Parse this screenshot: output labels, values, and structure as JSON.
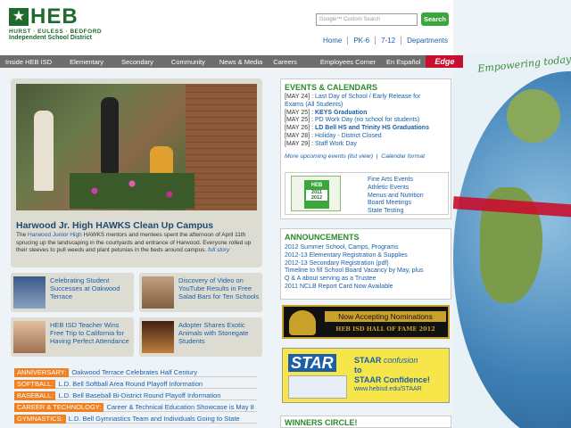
{
  "header": {
    "logo_main": "HEB",
    "logo_sub1": "HURST · EULESS · BEDFORD",
    "logo_sub2": "Independent School District",
    "search_placeholder": "Google™ Custom Search",
    "search_button": "Search",
    "top_links": [
      "Home",
      "PK-6",
      "7-12",
      "Departments"
    ]
  },
  "nav": {
    "items": [
      "Inside HEB ISD",
      "Elementary",
      "Secondary",
      "Community",
      "News & Media",
      "Careers",
      "Employees Corner",
      "En Español"
    ],
    "edge": "Edge"
  },
  "tagline": "Empowering today to...",
  "feature": {
    "title": "Harwood Jr. High HAWKS Clean Up Campus",
    "text_before": "The ",
    "link": "Harwood Junior High",
    "text_after": " HAWKS mentors and mentees spent the afternoon of April 11th sprucing up the landscaping in the courtyards and entrance of Harwood. Everyone rolled up their sleeves to pull weeds and plant petunias in the beds around campus.",
    "full_story": "full story"
  },
  "tiles": [
    {
      "text": "Celebrating Student Successes at Oakwood Terrace"
    },
    {
      "text": "Discovery of Video on YouTube Results in Free Salad Bars for Ten Schools"
    },
    {
      "text": "HEB ISD Teacher Wins Free Trip to California for Having Perfect Attendance"
    },
    {
      "text": "Adopter Shares Exotic Animals with Stonegate Students"
    }
  ],
  "news": [
    {
      "tag": "ANNIVERSARY:",
      "text": "Oakwood Terrace Celebrates Half Century"
    },
    {
      "tag": "SOFTBALL:",
      "text": "L.D. Bell Softball Area Round Playoff Information"
    },
    {
      "tag": "BASEBALL:",
      "text": "L.D. Bell Baseball Bi-District Round Playoff Information"
    },
    {
      "tag": "CAREER & TECHNOLOGY:",
      "text": "Career & Technical Education Showcase is May 8"
    },
    {
      "tag": "GYMNASTICS:",
      "text": "L.D. Bell Gymnastics Team and Individuals Going to State"
    }
  ],
  "events": {
    "title": "EVENTS & CALENDARS",
    "rows": [
      {
        "date": "[MAY 24] :",
        "text": "Last Day of School / Early Release for"
      },
      {
        "date": "",
        "text": "Exams (All Students)"
      },
      {
        "date": "[MAY 25] :",
        "text": "KEYS Graduation",
        "bold": true
      },
      {
        "date": "[MAY 25] :",
        "text": "PD Work Day (no school for students)"
      },
      {
        "date": "[MAY 26] :",
        "text": "LD Bell HS and Trinity HS Graduations",
        "bold": true
      },
      {
        "date": "[MAY 28] :",
        "text": "Holiday - District Closed"
      },
      {
        "date": "[MAY 29] :",
        "text": "Staff Work Day"
      }
    ],
    "more": "More upcoming events (list view)",
    "calendar": "Calendar format",
    "calendar_icon_top": "HEB",
    "calendar_icon_year": "2011 2012",
    "links": [
      "Fine Arts Events",
      "Athletic Events",
      "Menus and Nutrition",
      "Board Meetings",
      "State Testing"
    ]
  },
  "announcements": {
    "title": "ANNOUNCEMENTS",
    "items": [
      "2012 Summer School, Camps, Programs",
      "2012-13 Elementary Registration & Supplies",
      "2012-13 Secondary Registration (pdf)",
      "Timeline to fill School Board Vacancy by May, plus",
      "Q & A about serving as a Trustee",
      "2011 NCLB Report Card Now Available"
    ]
  },
  "hof": {
    "line1": "Now Accepting Nominations",
    "line2": "HEB ISD HALL OF FAME 2012"
  },
  "star": {
    "word": "STAR",
    "line1": "STAAR",
    "conf": "confusion",
    "line2": "to",
    "line3": "STAAR Confidence!",
    "url": "www.hebisd.edu/STAAR"
  },
  "winners": "WINNERS CIRCLE!"
}
